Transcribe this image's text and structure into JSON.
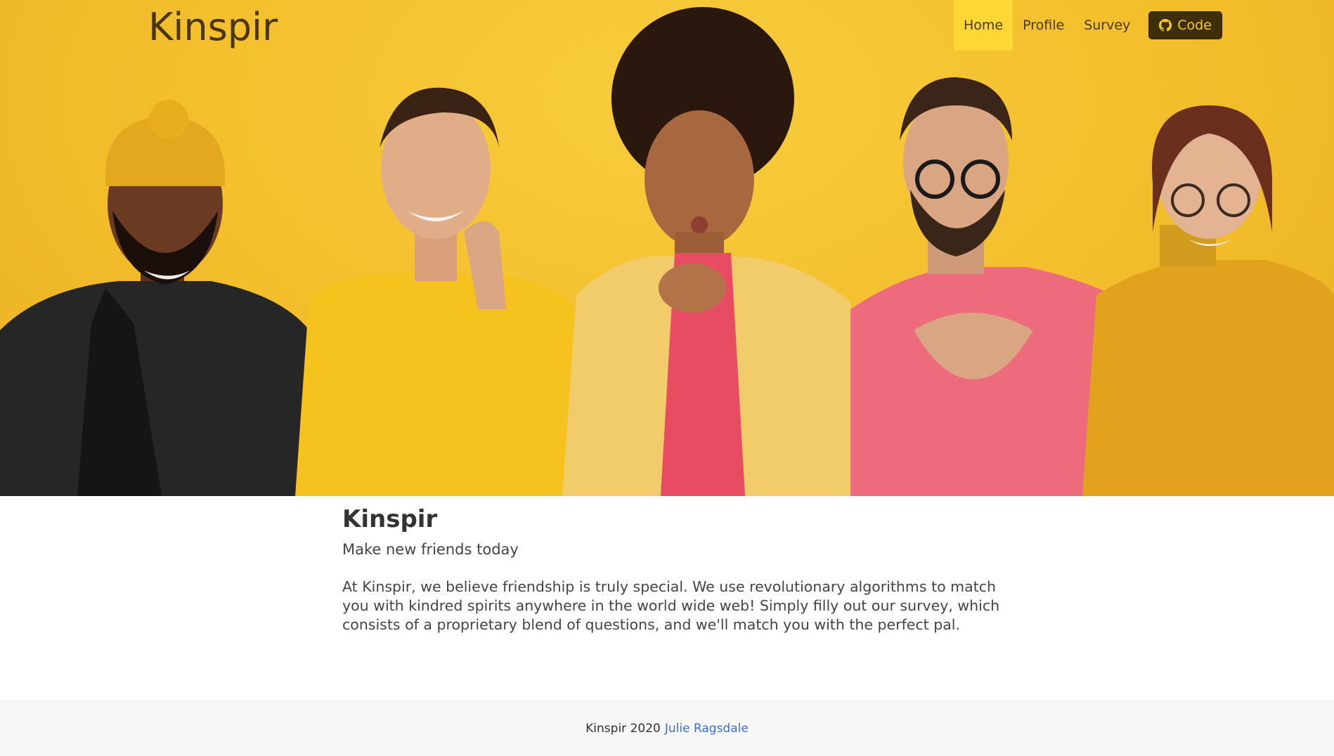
{
  "brand": "Kinspir",
  "nav": {
    "home": "Home",
    "profile": "Profile",
    "survey": "Survey",
    "code": "Code"
  },
  "icons": {
    "code_button": "github-icon"
  },
  "hero": {
    "alt": "Five smiling friends in yellow and pink outfits making friendly gestures"
  },
  "main": {
    "title": "Kinspir",
    "tagline": "Make new friends today",
    "description": "At Kinspir, we believe friendship is truly special. We use revolutionary algorithms to match you with kindred spirits anywhere in the world wide web! Simply filly out our survey, which consists of a proprietary blend of questions, and we'll match you with the perfect pal."
  },
  "footer": {
    "text": "Kinspir 2020",
    "author": "Julie Ragsdale"
  },
  "colors": {
    "hero_bg": "#f3be2c",
    "active_nav": "#fdd835",
    "code_button_bg": "#3f2f08",
    "code_button_text": "#f7c928",
    "link": "#3b6fc9",
    "footer_bg": "#f7f7f7"
  }
}
